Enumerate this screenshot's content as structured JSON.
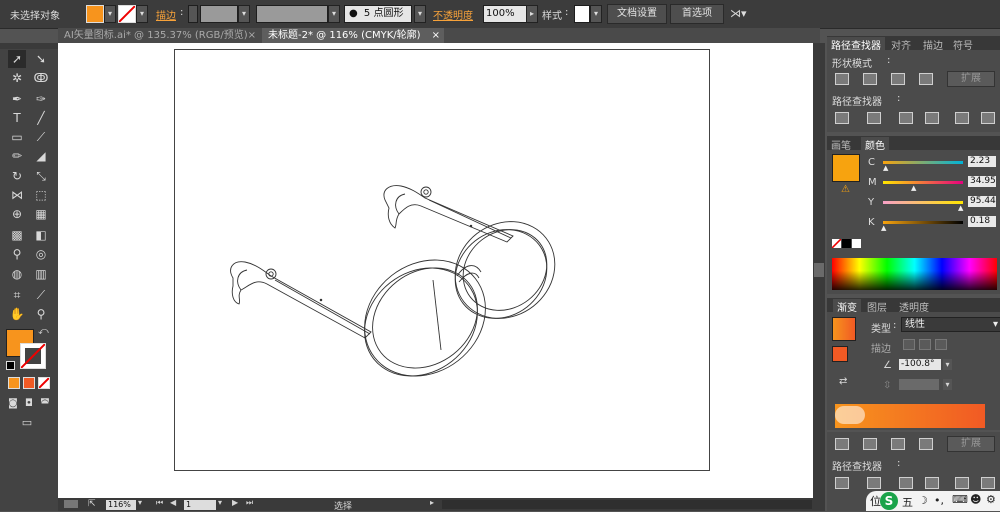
{
  "control_bar": {
    "selection_label": "未选择对象",
    "stroke_label": "描边",
    "brush_label": "5 点圆形",
    "opacity_label": "不透明度",
    "opacity_value": "100%",
    "style_label": "样式",
    "doc_settings_button": "文档设置",
    "preferences_button": "首选项"
  },
  "tabs": [
    {
      "label": "AI矢量图标.ai* @ 135.37% (RGB/预览)",
      "close": "×"
    },
    {
      "label": "未标题-2* @ 116% (CMYK/轮廓)",
      "close": "×"
    }
  ],
  "pathfinder_panel": {
    "tabs": [
      "路径查找器",
      "对齐",
      "描边",
      "符号"
    ],
    "shape_modes_label": "形状模式",
    "expand_button": "扩展",
    "pathfinder_label": "路径查找器"
  },
  "color_panel": {
    "tabs": [
      "画笔",
      "颜色"
    ],
    "channels": [
      {
        "name": "C",
        "value": "2.23",
        "fraction": 0.0223,
        "color": "#00b4d8"
      },
      {
        "name": "M",
        "value": "34.95",
        "fraction": 0.3495,
        "color": "#e6007e"
      },
      {
        "name": "Y",
        "value": "95.44",
        "fraction": 0.9544,
        "color": "#ffe600"
      },
      {
        "name": "K",
        "value": "0.18",
        "fraction": 0.0018,
        "color": "#000000"
      }
    ],
    "swatch_color": "#f7a30f"
  },
  "gradient_panel": {
    "tabs": [
      "渐变",
      "图层",
      "透明度"
    ],
    "type_label": "类型",
    "type_value": "线性",
    "stroke_label": "描边",
    "angle_value": "-100.8°",
    "gradient_start": "#f7941d",
    "gradient_end": "#f15a24"
  },
  "pathfinder_panel2": {
    "expand_button": "扩展",
    "pathfinder_label": "路径查找器"
  },
  "status_bar": {
    "zoom": "116%",
    "page": "1",
    "tool_status": "选择"
  },
  "tray": {
    "ime_text": "五",
    "pos_label": "位"
  },
  "colors": {
    "fill": "#f7941d",
    "accent_orange": "#f15a24"
  }
}
